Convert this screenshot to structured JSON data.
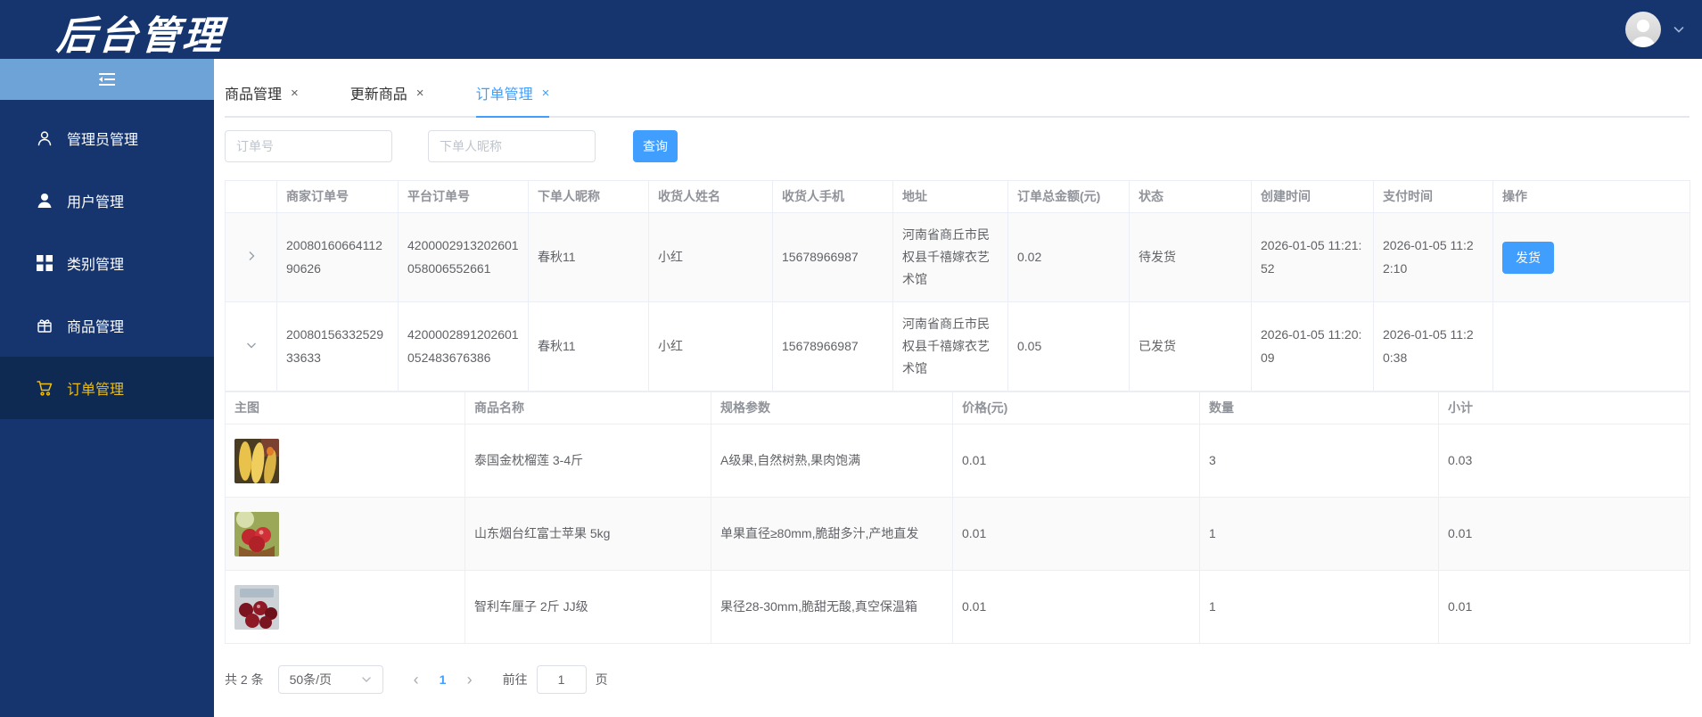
{
  "header": {
    "logo": "后台管理"
  },
  "sidebar": {
    "items": [
      {
        "label": "管理员管理",
        "icon": "admin-person-icon",
        "active": false
      },
      {
        "label": "用户管理",
        "icon": "user-filled-icon",
        "active": false
      },
      {
        "label": "类别管理",
        "icon": "category-grid-icon",
        "active": false
      },
      {
        "label": "商品管理",
        "icon": "product-gift-icon",
        "active": false
      },
      {
        "label": "订单管理",
        "icon": "order-cart-icon",
        "active": true
      }
    ]
  },
  "tabs": [
    {
      "label": "商品管理",
      "active": false
    },
    {
      "label": "更新商品",
      "active": false
    },
    {
      "label": "订单管理",
      "active": true
    }
  ],
  "search": {
    "order_no_placeholder": "订单号",
    "nickname_placeholder": "下单人昵称",
    "query_label": "查询"
  },
  "orders_table": {
    "headers": [
      "",
      "商家订单号",
      "平台订单号",
      "下单人昵称",
      "收货人姓名",
      "收货人手机",
      "地址",
      "订单总金额(元)",
      "状态",
      "创建时间",
      "支付时间",
      "操作"
    ],
    "rows": [
      {
        "expanded": false,
        "merchant_order_no": "2008016066411290626",
        "platform_order_no": "4200002913202601058006552661",
        "buyer_nickname": "春秋11",
        "receiver_name": "小红",
        "receiver_phone": "15678966987",
        "address": "河南省商丘市民权县千禧嫁衣艺术馆",
        "total_amount": "0.02",
        "status": "待发货",
        "created_at": "2026-01-05 11:21:52",
        "paid_at": "2026-01-05 11:22:10",
        "action_label": "发货"
      },
      {
        "expanded": true,
        "merchant_order_no": "2008015633252933633",
        "platform_order_no": "4200002891202601052483676386",
        "buyer_nickname": "春秋11",
        "receiver_name": "小红",
        "receiver_phone": "15678966987",
        "address": "河南省商丘市民权县千禧嫁衣艺术馆",
        "total_amount": "0.05",
        "status": "已发货",
        "created_at": "2026-01-05 11:20:09",
        "paid_at": "2026-01-05 11:20:38",
        "action_label": ""
      }
    ]
  },
  "items_table": {
    "headers": [
      "主图",
      "商品名称",
      "规格参数",
      "价格(元)",
      "数量",
      "小计"
    ],
    "rows": [
      {
        "image": "durian-thumbnail",
        "name": "泰国金枕榴莲 3-4斤",
        "spec": "A级果,自然树熟,果肉饱满",
        "price": "0.01",
        "quantity": "3",
        "subtotal": "0.03"
      },
      {
        "image": "apple-thumbnail",
        "name": "山东烟台红富士苹果 5kg",
        "spec": "单果直径≥80mm,脆甜多汁,产地直发",
        "price": "0.01",
        "quantity": "1",
        "subtotal": "0.01"
      },
      {
        "image": "cherry-thumbnail",
        "name": "智利车厘子 2斤 JJ级",
        "spec": "果径28-30mm,脆甜无酸,真空保温箱",
        "price": "0.01",
        "quantity": "1",
        "subtotal": "0.01"
      }
    ]
  },
  "pagination": {
    "total_text": "共 2 条",
    "page_size": "50条/页",
    "prev_glyph": "‹",
    "current_page": "1",
    "next_glyph": "›",
    "goto_label": "前往",
    "goto_value": "1",
    "page_suffix": "页"
  },
  "icons": {
    "tab_close_glyph": "×"
  },
  "colors": {
    "header_navy": "#16356e",
    "sidebar_active_bg": "#0f2a52",
    "sidebar_active_gold": "#eebe16",
    "collapse_bar_blue": "#6ea3d8",
    "accent_blue": "#409eff",
    "table_border": "#ebeef5",
    "header_text": "#909399",
    "body_text": "#606266"
  }
}
